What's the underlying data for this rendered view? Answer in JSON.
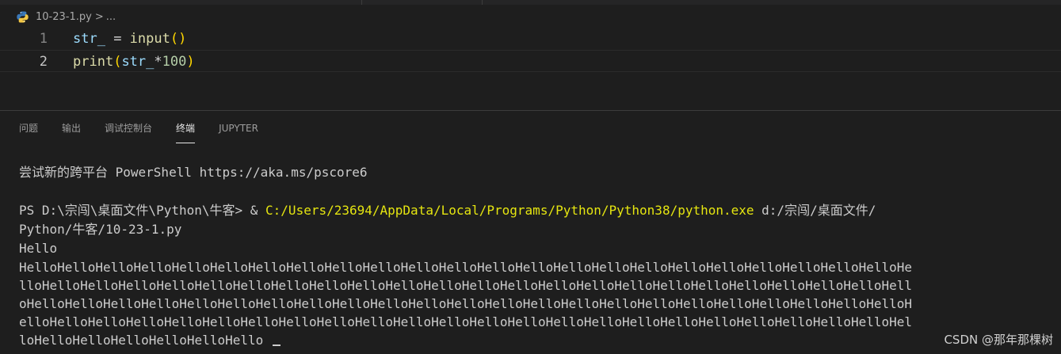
{
  "breadcrumb": {
    "file": "10-23-1.py",
    "separator": ">",
    "rest": "..."
  },
  "editor": {
    "lines": [
      {
        "number": "1",
        "tokens": [
          "str_",
          " = ",
          "input",
          "(",
          ")"
        ]
      },
      {
        "number": "2",
        "tokens": [
          "print",
          "(",
          "str_",
          "*",
          "100",
          ")"
        ]
      }
    ]
  },
  "panel": {
    "tabs": [
      {
        "label": "问题",
        "active": false
      },
      {
        "label": "输出",
        "active": false
      },
      {
        "label": "调试控制台",
        "active": false
      },
      {
        "label": "终端",
        "active": true
      },
      {
        "label": "JUPYTER",
        "active": false
      }
    ]
  },
  "terminal": {
    "banner": "尝试新的跨平台 PowerShell https://aka.ms/pscore6",
    "prompt": "PS D:\\宗闯\\桌面文件\\Python\\牛客> ",
    "ampersand": "& ",
    "exe_path": "C:/Users/23694/AppData/Local/Programs/Python/Python38/python.exe",
    "arg_line1": " d:/宗闯/桌面文件/",
    "arg_line2": "Python/牛客/10-23-1.py",
    "input_echo": "Hello",
    "output_lines": [
      "HelloHelloHelloHelloHelloHelloHelloHelloHelloHelloHelloHelloHelloHelloHelloHelloHelloHelloHelloHelloHelloHelloHelloHe",
      "lloHelloHelloHelloHelloHelloHelloHelloHelloHelloHelloHelloHelloHelloHelloHelloHelloHelloHelloHelloHelloHelloHelloHell",
      "oHelloHelloHelloHelloHelloHelloHelloHelloHelloHelloHelloHelloHelloHelloHelloHelloHelloHelloHelloHelloHelloHelloHelloH",
      "elloHelloHelloHelloHelloHelloHelloHelloHelloHelloHelloHelloHelloHelloHelloHelloHelloHelloHelloHelloHelloHelloHelloHel",
      "loHelloHelloHelloHelloHelloHello"
    ]
  },
  "watermark": "CSDN @那年那棵树",
  "colors": {
    "background": "#1e1e1e",
    "exe_path": "#e5e510",
    "function": "#dcdcaa",
    "variable": "#9cdcfe",
    "bracket": "#ffd700",
    "number": "#b5cea8"
  },
  "icons": {
    "file": "python-icon"
  }
}
